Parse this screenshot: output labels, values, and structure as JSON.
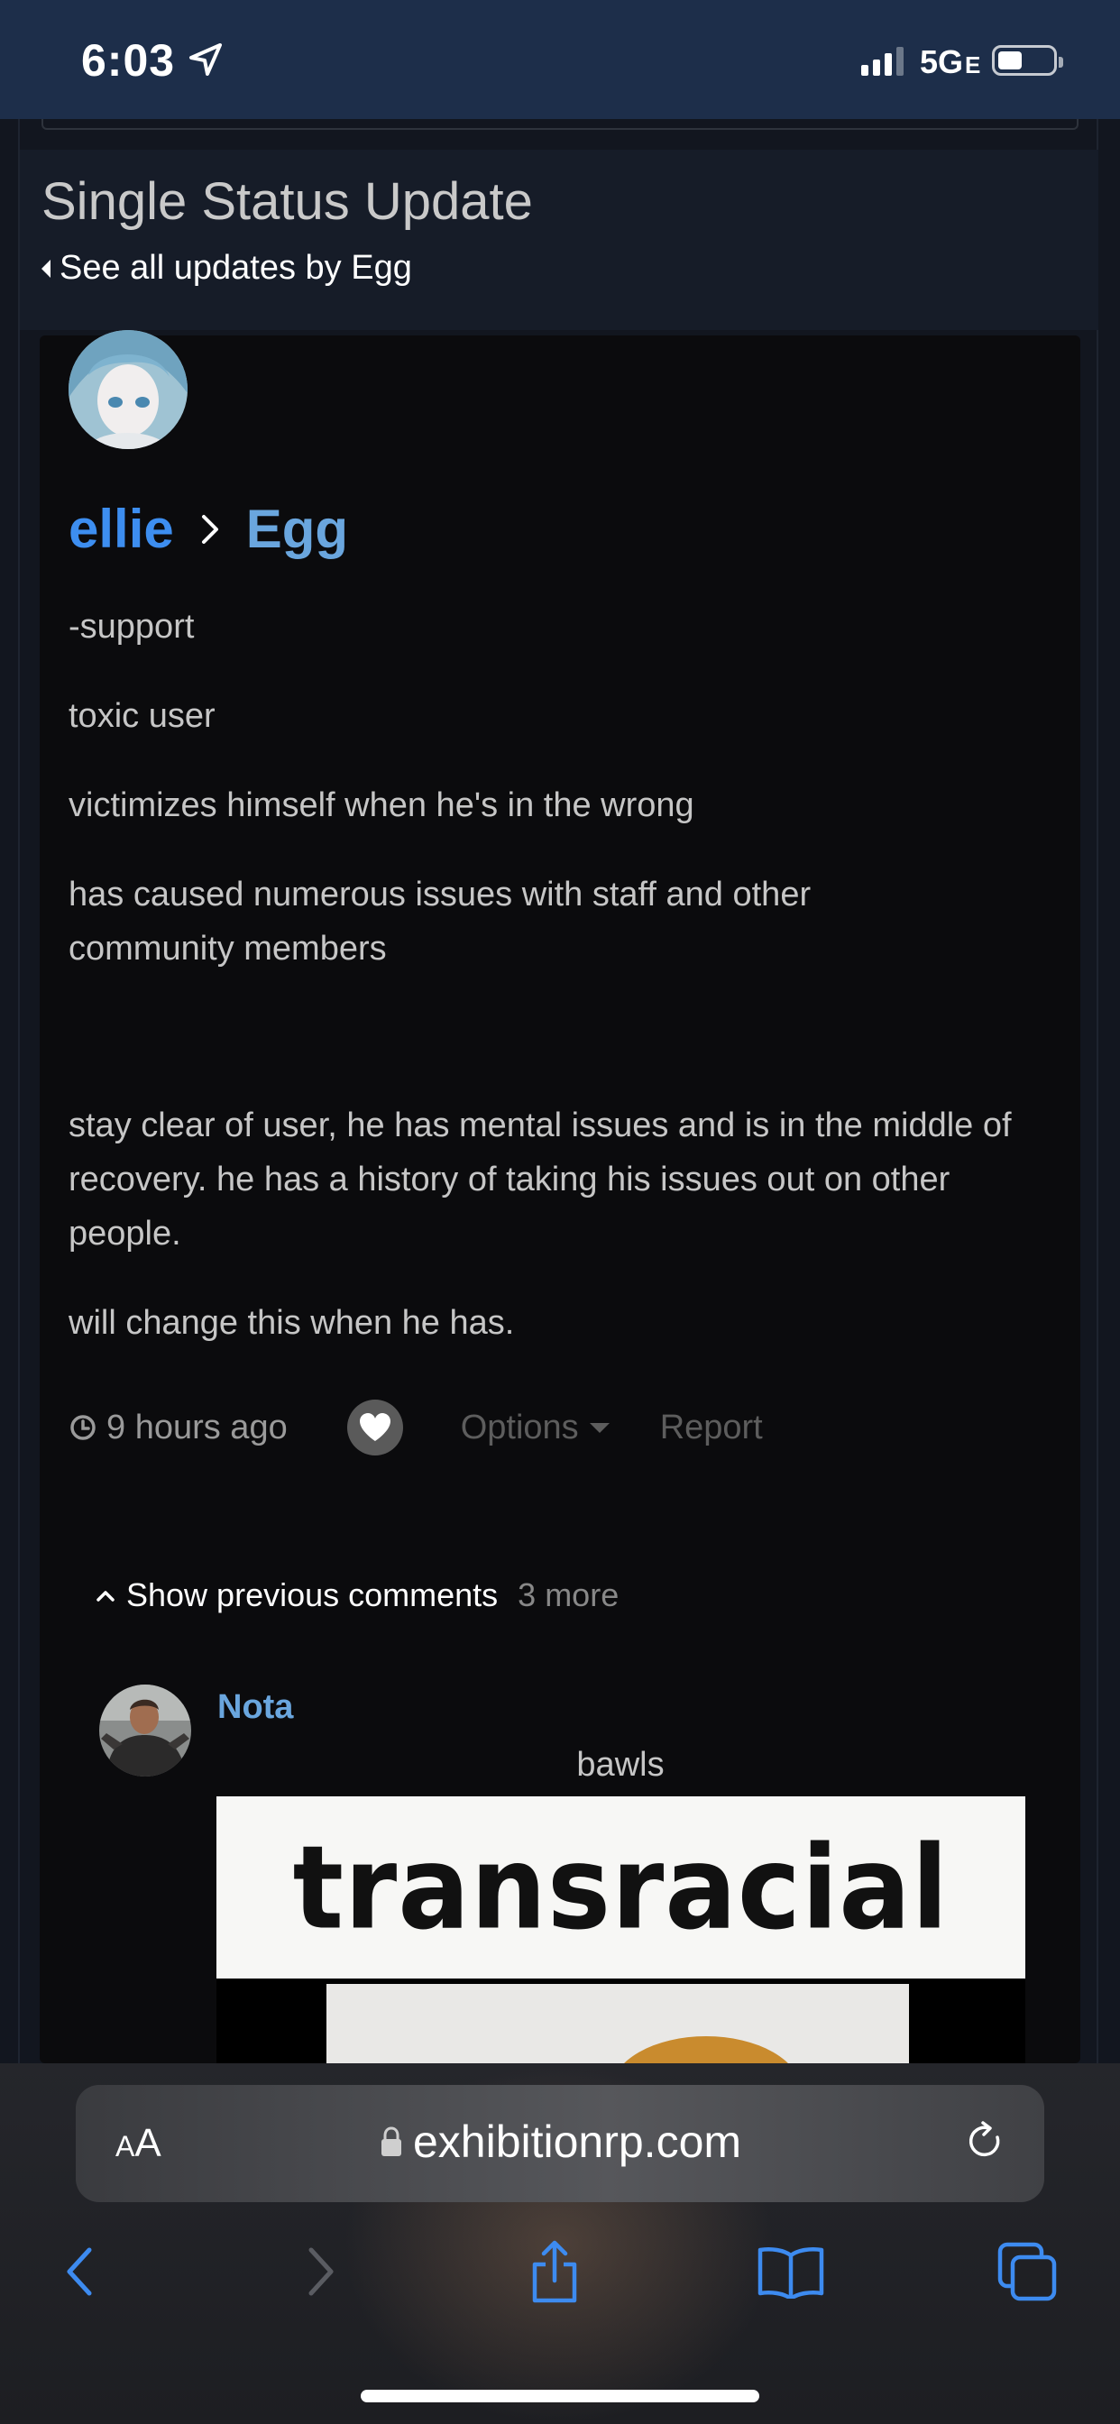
{
  "status_bar": {
    "time": "6:03",
    "network": "5G",
    "network_suffix": "E"
  },
  "header": {
    "title": "Single Status Update",
    "back_link": "See all updates by Egg"
  },
  "status": {
    "author": "ellie",
    "target": "Egg",
    "paragraphs": [
      "-support",
      "toxic user",
      "victimizes himself when he's in the wrong",
      "has caused numerous issues with staff and other community members",
      "stay clear of user, he has mental issues and is in the middle of recovery. he has a history of taking his issues out on other people.",
      "will change this when he has."
    ],
    "time_ago": "9 hours ago",
    "options_label": "Options",
    "report_label": "Report"
  },
  "comments": {
    "show_previous_label": "Show previous comments",
    "more_count": "3 more",
    "items": [
      {
        "author": "Nota",
        "text": "bawls",
        "image_caption": "transracial"
      }
    ]
  },
  "browser": {
    "text_size_label_big": "A",
    "text_size_label_small": "A",
    "url": "exhibitionrp.com"
  },
  "icons": [
    "location-arrow-icon",
    "signal-icon",
    "battery-icon",
    "caret-left-icon",
    "chevron-right-icon",
    "clock-icon",
    "heart-icon",
    "caret-down-icon",
    "caret-up-icon",
    "lock-icon",
    "reload-icon",
    "back-icon",
    "forward-icon",
    "share-icon",
    "bookmarks-icon",
    "tabs-icon"
  ]
}
